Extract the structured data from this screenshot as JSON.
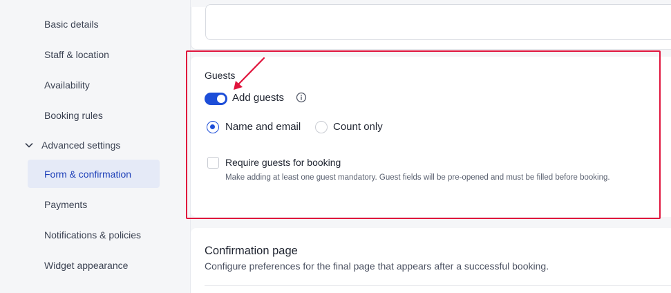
{
  "sidebar": {
    "items": [
      {
        "label": "Basic details"
      },
      {
        "label": "Staff & location"
      },
      {
        "label": "Availability"
      },
      {
        "label": "Booking rules"
      },
      {
        "label": "Advanced settings"
      },
      {
        "label": "Form & confirmation"
      },
      {
        "label": "Payments"
      },
      {
        "label": "Notifications & policies"
      },
      {
        "label": "Widget appearance"
      }
    ],
    "active_index": 5,
    "expanded_section": "Advanced settings"
  },
  "guests": {
    "title": "Guests",
    "toggle_label": "Add guests",
    "toggle_on": true,
    "radio_options": [
      {
        "label": "Name and email",
        "checked": true
      },
      {
        "label": "Count only",
        "checked": false
      }
    ],
    "require_label": "Require guests for booking",
    "require_checked": false,
    "require_help": "Make adding at least one guest mandatory. Guest fields will be pre-opened and must be filled before booking."
  },
  "confirmation": {
    "title": "Confirmation page",
    "description": "Configure preferences for the final page that appears after a successful booking."
  },
  "colors": {
    "accent": "#1d4ed8",
    "active_bg": "#e5eaf7",
    "highlight": "#e0143c"
  },
  "icons": {
    "info": "info-icon",
    "chevron": "chevron-down-icon",
    "annotation": "arrow-annotation"
  }
}
